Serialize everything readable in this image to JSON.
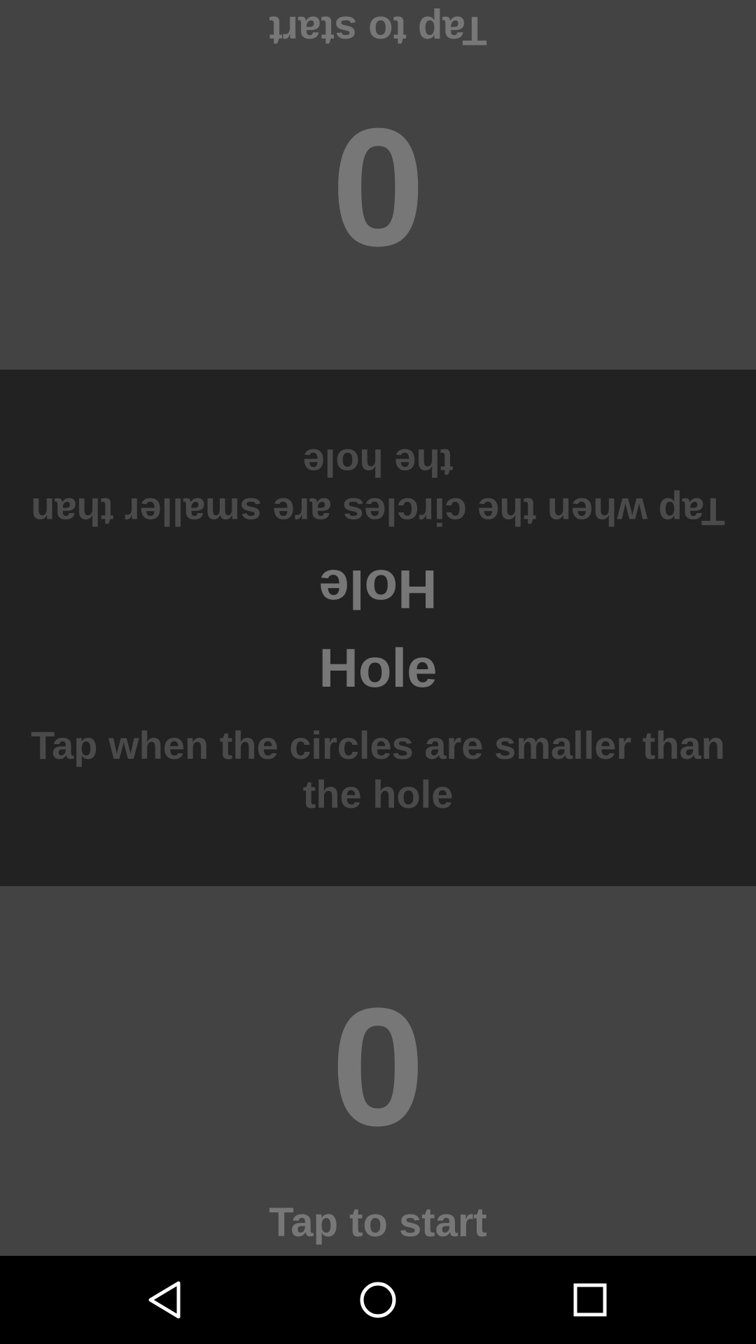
{
  "top_player": {
    "score": "0",
    "start_label": "Tap to start"
  },
  "bottom_player": {
    "score": "0",
    "start_label": "Tap to start"
  },
  "mode": {
    "title": "Hole",
    "description": "Tap when the circles are smaller than the hole"
  },
  "navbar": {
    "back_icon": "back-triangle-icon",
    "home_icon": "home-circle-icon",
    "recents_icon": "recents-square-icon"
  },
  "colors": {
    "player_panel": "#434343",
    "middle_panel": "#222222",
    "text_primary": "#777777",
    "text_secondary": "#4a4a4a",
    "navbar": "#000000",
    "nav_icon": "#ffffff"
  }
}
